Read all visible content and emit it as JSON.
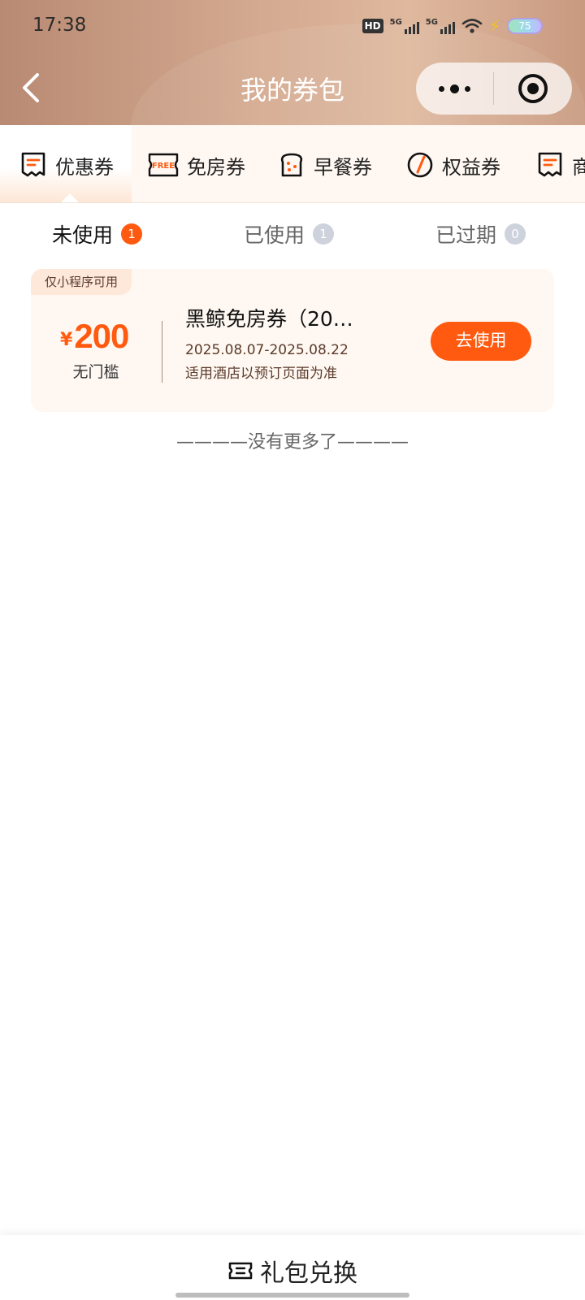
{
  "status_bar": {
    "time": "17:38",
    "hd": "HD",
    "network_1": "5G",
    "network_2": "5G",
    "battery": "75"
  },
  "header": {
    "title": "我的券包"
  },
  "categories": [
    {
      "label": "优惠券",
      "icon": "coupon-receipt-icon"
    },
    {
      "label": "免房券",
      "icon": "free-ticket-icon",
      "icon_text": "FREE"
    },
    {
      "label": "早餐券",
      "icon": "toast-bread-icon"
    },
    {
      "label": "权益券",
      "icon": "gauge-icon"
    },
    {
      "label": "商",
      "icon": "coupon-receipt-icon"
    }
  ],
  "status_tabs": [
    {
      "label": "未使用",
      "count": "1"
    },
    {
      "label": "已使用",
      "count": "1"
    },
    {
      "label": "已过期",
      "count": "0"
    }
  ],
  "coupon": {
    "tag": "仅小程序可用",
    "currency": "¥",
    "amount": "200",
    "threshold": "无门槛",
    "name": "黑鲸免房券（20…",
    "date_range": "2025.08.07-2025.08.22",
    "scope": "适用酒店以预订页面为准",
    "button": "去使用"
  },
  "list_end_text": "————没有更多了————",
  "bottom": {
    "label": "礼包兑换",
    "icon": "ticket-icon"
  },
  "colors": {
    "accent": "#ff5a0f",
    "header_bg": "#c9a085"
  }
}
